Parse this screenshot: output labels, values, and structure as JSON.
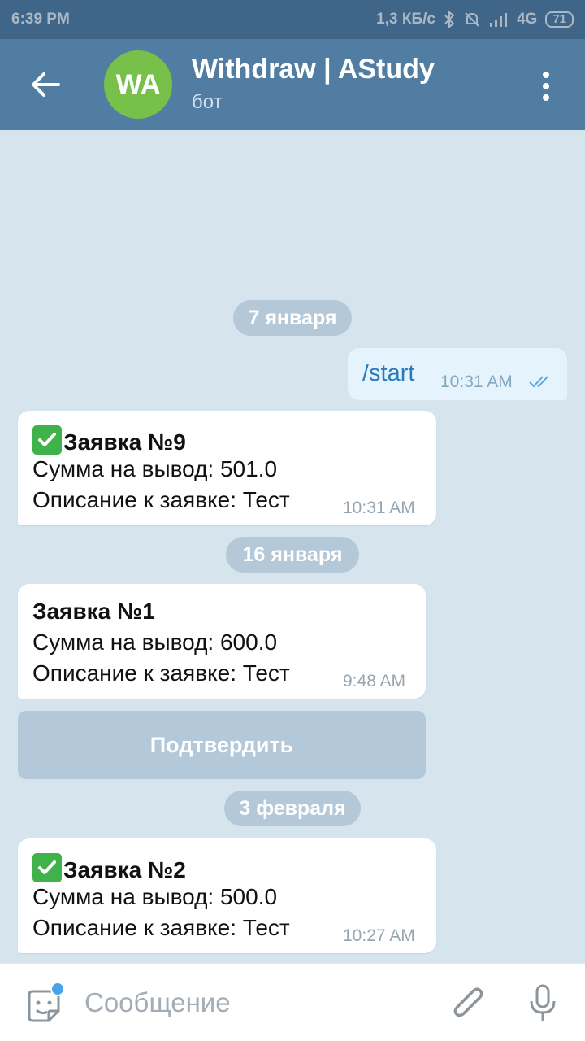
{
  "status_bar": {
    "time": "6:39 PM",
    "net_speed": "1,3 КБ/с",
    "network": "4G",
    "battery": "71"
  },
  "header": {
    "avatar_initials": "WA",
    "title": "Withdraw | AStudy",
    "subtitle": "бот"
  },
  "chat": {
    "dates": [
      "7 января",
      "16 января",
      "3 февраля"
    ],
    "outgoing": {
      "text": "/start",
      "time": "10:31 AM"
    },
    "messages": [
      {
        "verified": true,
        "title": "Заявка №9",
        "amount": "Сумма на вывод: 501.0",
        "description": "Описание к заявке: Тест",
        "time": "10:31 AM"
      },
      {
        "verified": false,
        "title": "Заявка №1",
        "amount": "Сумма на вывод: 600.0",
        "description": "Описание к заявке: Тест",
        "time": "9:48 AM"
      },
      {
        "verified": true,
        "title": "Заявка №2",
        "amount": "Сумма на вывод: 500.0",
        "description": "Описание к заявке: Тест",
        "time": "10:27 AM"
      }
    ],
    "confirm_button": "Подтвердить"
  },
  "composer": {
    "placeholder": "Сообщение"
  },
  "colors": {
    "header_bg": "#517da2",
    "chat_bg": "#d6e4ee",
    "avatar_bg": "#77c04a",
    "check_green": "#3fb34a",
    "link_blue": "#2a7bbd"
  },
  "icons": [
    "back-arrow-icon",
    "more-vert-icon",
    "check-mark-icon",
    "double-check-icon",
    "sticker-icon",
    "attach-icon",
    "mic-icon",
    "bluetooth-icon",
    "mute-icon"
  ]
}
